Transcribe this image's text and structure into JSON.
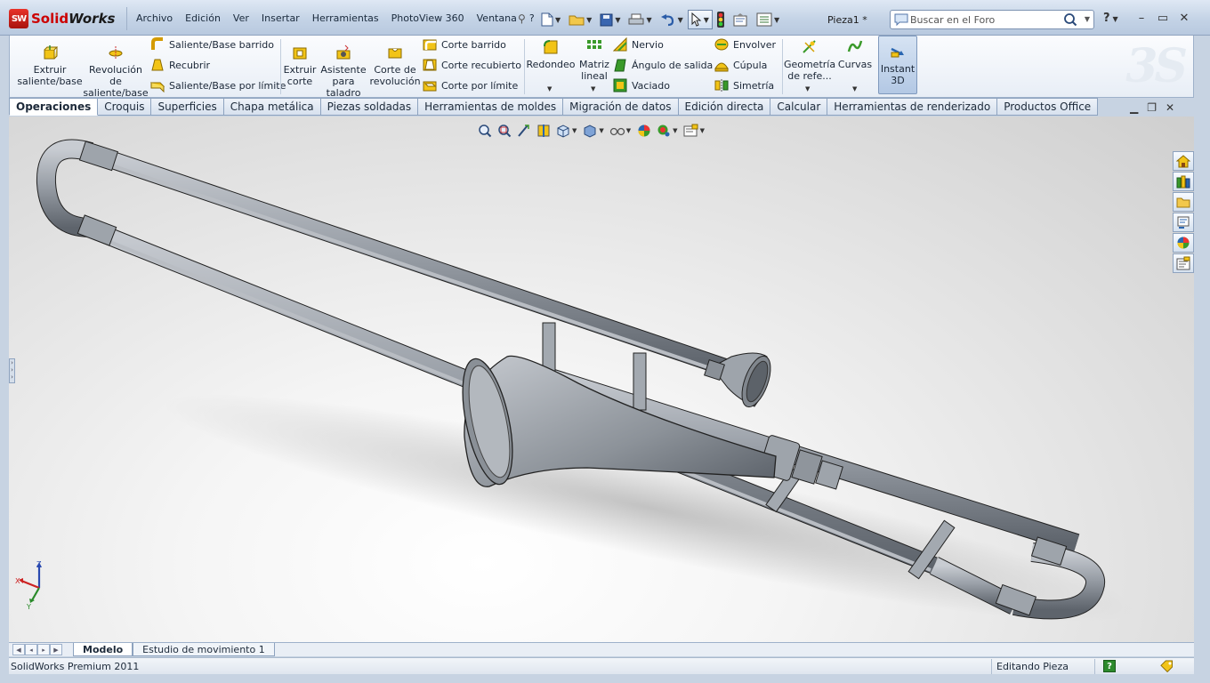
{
  "app": {
    "logo_badge": "SW",
    "logo_solid": "Solid",
    "logo_works": "Works",
    "document_title": "Pieza1 *"
  },
  "menu": [
    "Archivo",
    "Edición",
    "Ver",
    "Insertar",
    "Herramientas",
    "PhotoView 360",
    "Ventana",
    "?"
  ],
  "search": {
    "placeholder": "Buscar en el Foro"
  },
  "help_label": "?",
  "ribbon": {
    "extrude_boss": "Extruir saliente/base",
    "revolve_boss": "Revolución de saliente/base",
    "swept_boss": "Saliente/Base barrido",
    "loft": "Recubrir",
    "boundary_boss": "Saliente/Base por límite",
    "extruded_cut": "Extruir corte",
    "hole_wizard": "Asistente para taladro",
    "revolved_cut": "Corte de revolución",
    "swept_cut": "Corte barrido",
    "lofted_cut": "Corte recubierto",
    "boundary_cut": "Corte por límite",
    "fillet": "Redondeo",
    "linear_pattern": "Matriz lineal",
    "rib": "Nervio",
    "draft": "Ángulo de salida",
    "shell": "Vaciado",
    "wrap": "Envolver",
    "dome": "Cúpula",
    "mirror": "Simetría",
    "ref_geometry": "Geometría de refe...",
    "curves": "Curvas",
    "instant3d": "Instant 3D"
  },
  "tabs": [
    "Operaciones",
    "Croquis",
    "Superficies",
    "Chapa metálica",
    "Piezas soldadas",
    "Herramientas de moldes",
    "Migración de datos",
    "Edición directa",
    "Calcular",
    "Herramientas de renderizado",
    "Productos Office"
  ],
  "active_tab": "Operaciones",
  "bottom_tabs": [
    "Modelo",
    "Estudio de movimiento 1"
  ],
  "status": {
    "product": "SolidWorks Premium 2011",
    "mode": "Editando Pieza",
    "help": "?"
  },
  "triad": {
    "x": "X",
    "y": "Y",
    "z": "Z"
  },
  "colors": {
    "titlebar": "#c4d3e6",
    "viewport_bg": "#f5f5f5",
    "model_gray": "#9aa0a8",
    "accent_yellow": "#f2c417",
    "accent_green": "#3a9a2a"
  }
}
